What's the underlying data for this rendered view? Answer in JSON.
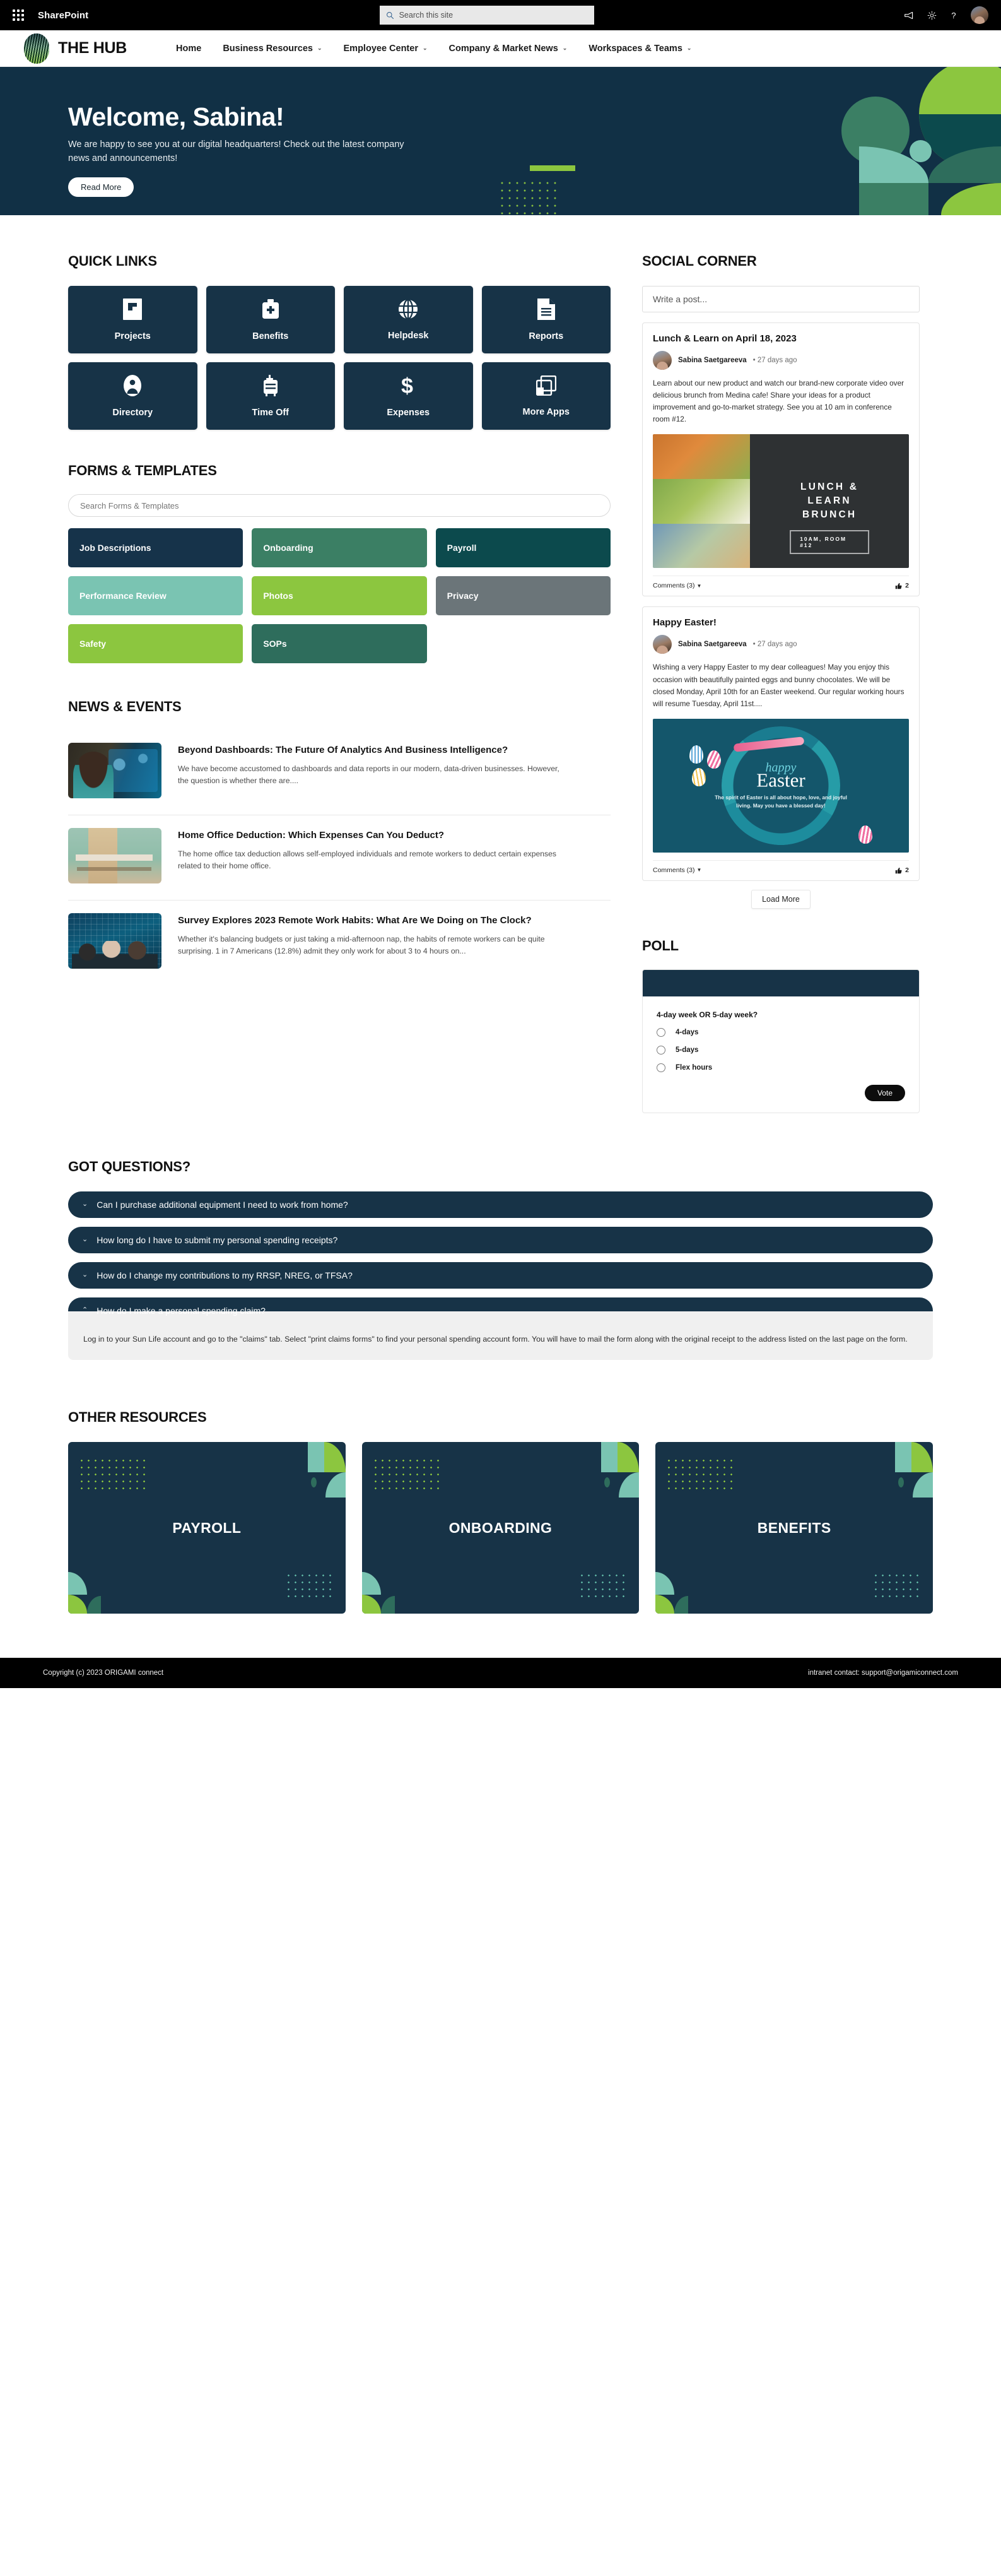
{
  "suite_bar": {
    "app_launcher": "waffle-icon",
    "title": "SharePoint",
    "search_placeholder": "Search this site",
    "icons": [
      "megaphone-icon",
      "gear-icon",
      "help-icon",
      "user-avatar"
    ]
  },
  "site_header": {
    "brand": "THE HUB",
    "nav": [
      {
        "label": "Home",
        "has_caret": false
      },
      {
        "label": "Business Resources",
        "has_caret": true
      },
      {
        "label": "Employee Center",
        "has_caret": true
      },
      {
        "label": "Company & Market News",
        "has_caret": true
      },
      {
        "label": "Workspaces & Teams",
        "has_caret": true
      }
    ]
  },
  "hero": {
    "heading": "Welcome, Sabina!",
    "body": "We are happy to see you at our digital headquarters! Check out the latest company news and announcements!",
    "button": "Read More"
  },
  "quick_links": {
    "title": "QUICK LINKS",
    "items": [
      {
        "label": "Projects",
        "icon": "flag-document-icon"
      },
      {
        "label": "Benefits",
        "icon": "medical-kit-icon"
      },
      {
        "label": "Helpdesk",
        "icon": "globe-icon"
      },
      {
        "label": "Reports",
        "icon": "document-lines-icon"
      },
      {
        "label": "Directory",
        "icon": "person-badge-icon"
      },
      {
        "label": "Time Off",
        "icon": "suitcase-icon"
      },
      {
        "label": "Expenses",
        "icon": "dollar-sign-icon"
      },
      {
        "label": "More Apps",
        "icon": "windows-stack-icon"
      }
    ]
  },
  "forms_templates": {
    "title": "FORMS & TEMPLATES",
    "search_placeholder": "Search Forms & Templates",
    "tiles": [
      {
        "label": "Job Descriptions",
        "color": "#16334a"
      },
      {
        "label": "Onboarding",
        "color": "#3b7f64"
      },
      {
        "label": "Payroll",
        "color": "#0c4a4d"
      },
      {
        "label": "Performance Review",
        "color": "#7ac4b2"
      },
      {
        "label": "Photos",
        "color": "#8cc63f"
      },
      {
        "label": "Privacy",
        "color": "#6b7579"
      },
      {
        "label": "Safety",
        "color": "#8cc63f"
      },
      {
        "label": "SOPs",
        "color": "#2e6d5c"
      }
    ]
  },
  "news": {
    "title": "NEWS & EVENTS",
    "items": [
      {
        "title": "Beyond Dashboards: The Future Of Analytics And Business Intelligence?",
        "desc": "We have become accustomed to dashboards and data reports in our modern, data-driven businesses. However, the question is whether there are....",
        "thumb": "analytics-photo"
      },
      {
        "title": "Home Office Deduction: Which Expenses Can You Deduct?",
        "desc": "The home office tax deduction allows self-employed individuals and remote workers to deduct certain expenses related to their home office.",
        "thumb": "home-office-photo"
      },
      {
        "title": "Survey Explores 2023 Remote Work Habits: What Are We Doing on The Clock?",
        "desc": "Whether it's balancing budgets or just taking a mid-afternoon nap, the habits of remote workers can be quite surprising. 1 in 7 Americans (12.8%) admit they only work for about 3 to 4 hours on...",
        "thumb": "coworking-photo"
      }
    ]
  },
  "social": {
    "title": "SOCIAL CORNER",
    "write_placeholder": "Write a post...",
    "posts": [
      {
        "title": "Lunch & Learn on April 18, 2023",
        "author": "Sabina Saetgareeva",
        "separator": "•",
        "time": "27 days ago",
        "text": "Learn about our new product and watch our brand-new corporate video over delicious brunch from Medina cafe! Share your ideas for a product improvement and go-to-market strategy. See you at 10 am in conference room #12.",
        "media": {
          "kind": "lunch-learn-poster",
          "line1": "LUNCH &",
          "line2": "LEARN",
          "line3": "BRUNCH",
          "badge": "10AM, ROOM #12"
        },
        "comments": "Comments (3)",
        "likes": "2"
      },
      {
        "title": "Happy Easter!",
        "author": "Sabina Saetgareeva",
        "separator": "•",
        "time": "27 days ago",
        "text": "Wishing a very Happy Easter to my dear colleagues! May you enjoy this occasion with beautifully painted eggs and bunny chocolates. We will be closed Monday, April 10th for an Easter weekend. Our regular working hours will resume Tuesday, April 11st....",
        "media": {
          "kind": "easter-card",
          "script": "happy",
          "headline": "Easter",
          "sub": "The spirit of Easter is all about hope, love, and joyful living. May you have a blessed day!"
        },
        "comments": "Comments (3)",
        "likes": "2"
      }
    ],
    "load_more": "Load More"
  },
  "poll": {
    "title": "POLL",
    "question": "4-day week OR 5-day week?",
    "options": [
      "4-days",
      "5-days",
      "Flex hours"
    ],
    "vote_button": "Vote"
  },
  "faq": {
    "title": "GOT QUESTIONS?",
    "items": [
      {
        "q": "Can I purchase additional equipment I need to work from home?",
        "open": false,
        "chev": "⌄"
      },
      {
        "q": "How long do I have to submit my personal spending receipts?",
        "open": false,
        "chev": "⌄"
      },
      {
        "q": "How do I change my contributions to my RRSP, NREG, or TFSA?",
        "open": false,
        "chev": "⌄"
      },
      {
        "q": "How do I make a personal spending claim?",
        "open": true,
        "chev": "⌃",
        "a": "Log in to your Sun Life account and go to the \"claims\" tab. Select \"print claims forms\" to find your personal spending account form. You will have to mail the form along with the original receipt to the address listed on the last page on the form."
      }
    ]
  },
  "other_resources": {
    "title": "OTHER RESOURCES",
    "cards": [
      {
        "label": "PAYROLL"
      },
      {
        "label": "ONBOARDING"
      },
      {
        "label": "BENEFITS"
      }
    ]
  },
  "footer": {
    "copyright": "Copyright (c) 2023 ORIGAMI connect",
    "contact": "intranet contact: support@origamiconnect.com"
  },
  "colors": {
    "navy": "#173347",
    "hero_navy": "#113045",
    "lime": "#8cc63f",
    "teal": "#3b7f64",
    "mint": "#7ac4b2",
    "dark_teal": "#0c4a4d",
    "grey": "#6b7579"
  }
}
